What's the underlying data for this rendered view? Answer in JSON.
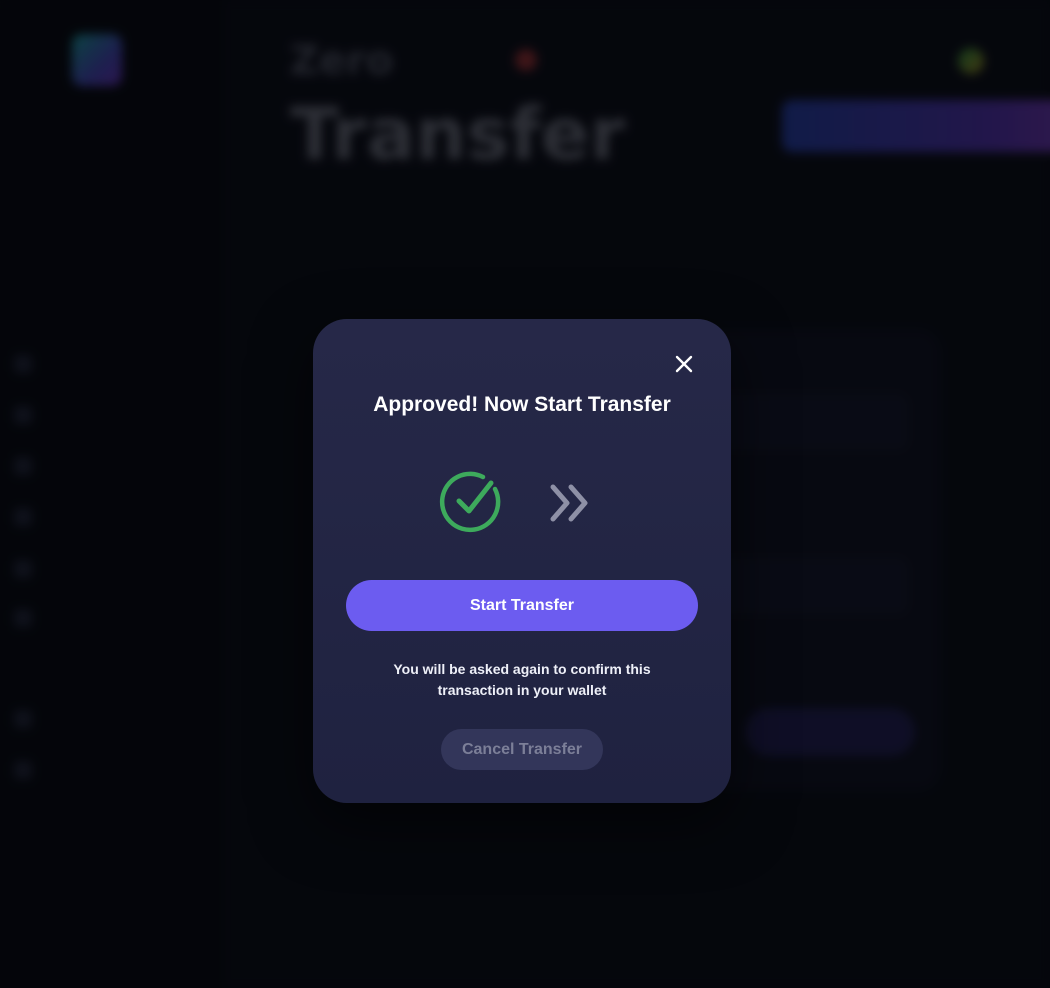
{
  "background": {
    "hero_small": "Zero",
    "hero_big": "Transfer",
    "nav_icons": [
      "nav-icon",
      "nav-icon",
      "nav-icon",
      "nav-icon",
      "nav-icon",
      "nav-icon",
      "nav-icon",
      "nav-icon"
    ]
  },
  "modal": {
    "title": "Approved! Now Start Transfer",
    "status_icons": [
      "check-circle-icon",
      "double-chevron-right-icon"
    ],
    "start_button_label": "Start Transfer",
    "note": "You will be asked again to confirm this transaction in your wallet",
    "cancel_button_label": "Cancel Transfer"
  },
  "colors": {
    "accent": "#6c5cf0",
    "success": "#3daa5c",
    "modal_bg": "#24264a",
    "muted_icon": "#8e90a6"
  }
}
